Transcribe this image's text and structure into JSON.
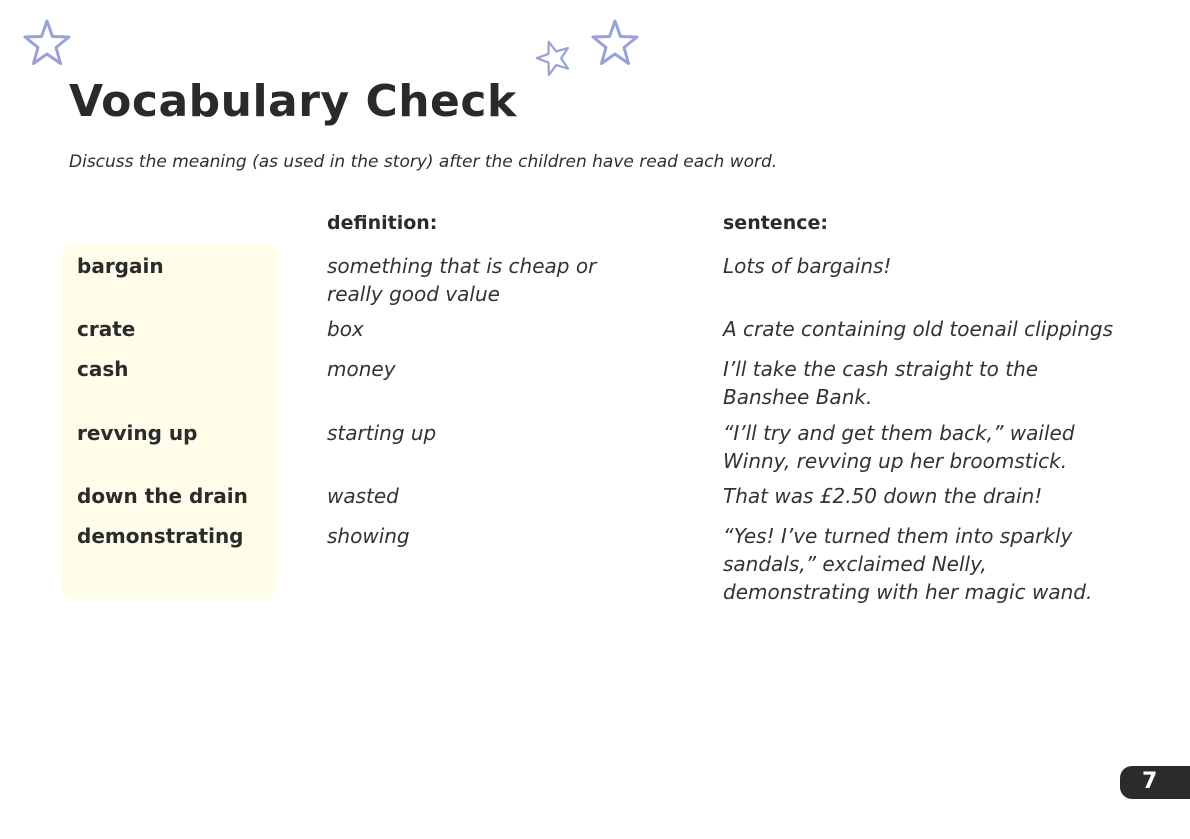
{
  "document": {
    "title": "Vocabulary Check",
    "instructions": "Discuss the meaning (as used in the story) after the children have read each word.",
    "columns": {
      "definition": "definition:",
      "sentence": "sentence:"
    },
    "rows": [
      {
        "word": "bargain",
        "definition": "something that is cheap or really good value",
        "sentence": "Lots of bargains!"
      },
      {
        "word": "crate",
        "definition": "box",
        "sentence": "A crate containing old toenail clippings"
      },
      {
        "word": "cash",
        "definition": "money",
        "sentence": "I’ll take the cash straight to the Banshee Bank."
      },
      {
        "word": "revving up",
        "definition": "starting up",
        "sentence": "“I’ll try and get them back,” wailed Winny, revving up her broomstick."
      },
      {
        "word": "down the drain",
        "definition": "wasted",
        "sentence": "That was £2.50 down the drain!"
      },
      {
        "word": "demonstrating",
        "definition": "showing",
        "sentence": "“Yes! I’ve turned them into sparkly sandals,” exclaimed Nelly, demonstrating with her magic wand."
      }
    ],
    "page_number": "7"
  },
  "colors": {
    "star_outline": "#97a3d6",
    "word_panel": "#fefde9",
    "text": "#2b2b2b",
    "page_badge": "#2b2b2b"
  },
  "icons": [
    "star-icon",
    "star-icon",
    "star-icon"
  ]
}
